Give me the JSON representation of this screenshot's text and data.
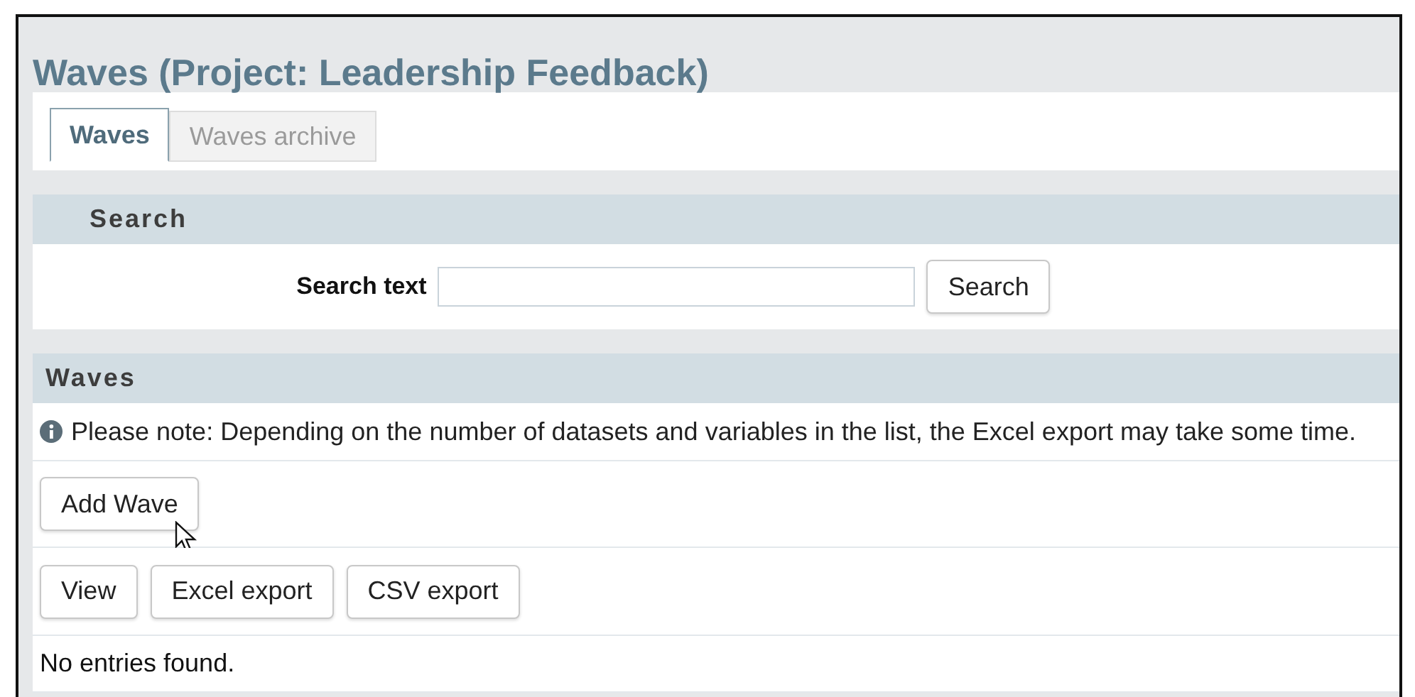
{
  "page_title": "Waves (Project: Leadership Feedback)",
  "tabs": [
    {
      "label": "Waves",
      "selected": true
    },
    {
      "label": "Waves archive",
      "selected": false
    }
  ],
  "search_section": {
    "heading": "Search",
    "label": "Search text",
    "button": "Search"
  },
  "waves_section": {
    "heading": "Waves",
    "note": "Please note: Depending on the number of datasets and variables in the list, the Excel export may take some time.",
    "add_button": "Add Wave",
    "actions": [
      "View",
      "Excel export",
      "CSV export"
    ],
    "empty_message": "No entries found."
  }
}
